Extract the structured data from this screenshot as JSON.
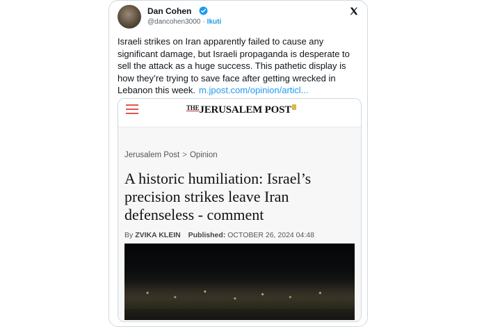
{
  "tweet": {
    "author_name": "Dan Cohen",
    "handle": "@dancohen3000",
    "separator": "·",
    "follow_label": "Ikuti",
    "text": "Israeli strikes on Iran apparently failed to cause any significant damage, but Israeli propaganda is desperate to sell the attack as a huge success. This pathetic display is how they’re trying to save face after getting wrecked in Lebanon this week.",
    "link": "m.jpost.com/opinion/articl...",
    "verified_color": "#1d9bf0",
    "link_color": "#1d9bf0"
  },
  "embed": {
    "site_logo": "THE JERUSALEM POST",
    "logo_the": "THE",
    "logo_main": "JERUSALEM POST",
    "menu_icon": "hamburger-menu-icon",
    "menu_color": "#e0544f",
    "breadcrumb": {
      "site": "Jerusalem Post",
      "separator": ">",
      "section": "Opinion"
    },
    "article_title": "A historic humiliation: Israel’s precision strikes leave Iran defenseless - comment",
    "byline": {
      "by": "By",
      "author": "ZVIKA KLEIN",
      "published_label": "Published:",
      "published_date": "OCTOBER 26, 2024 04:48"
    }
  }
}
